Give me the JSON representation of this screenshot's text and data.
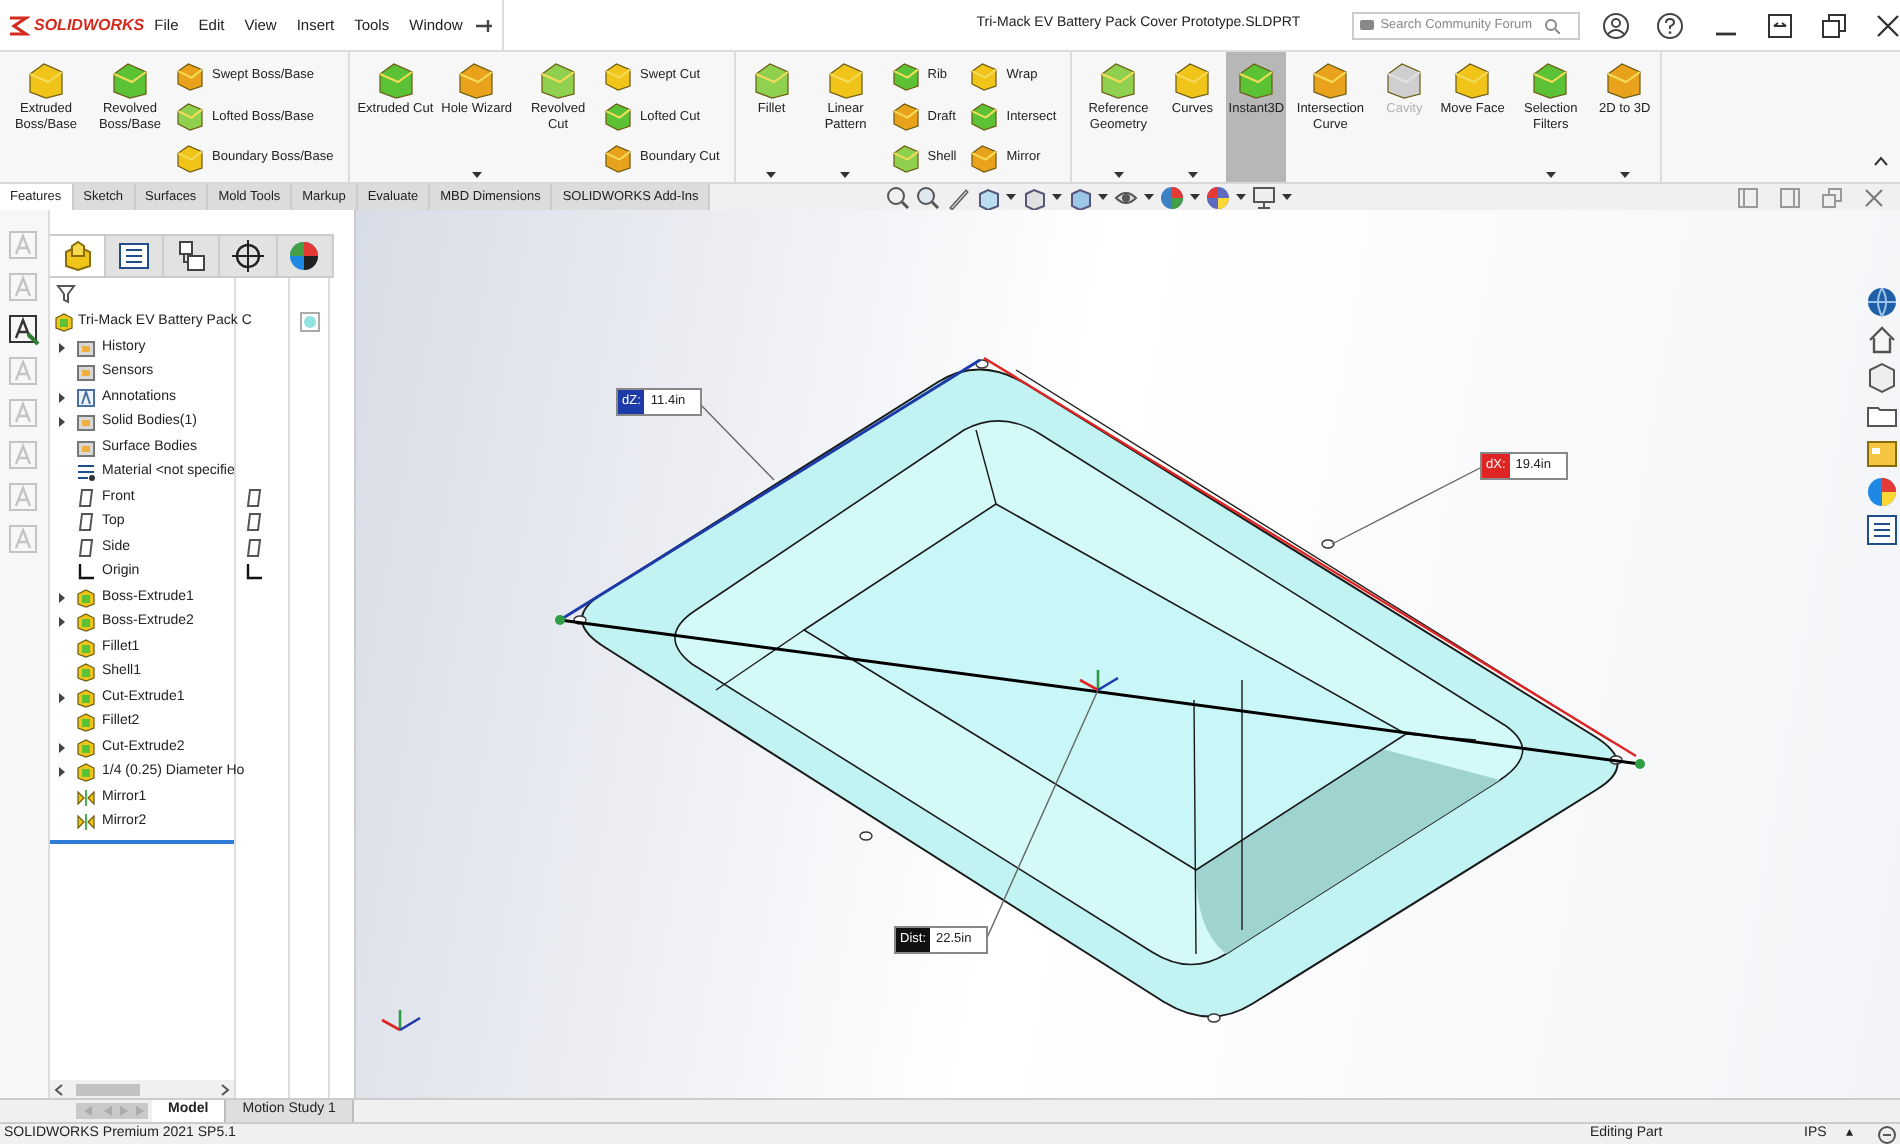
{
  "app": {
    "logo": "SOLIDWORKS",
    "menu": [
      "File",
      "Edit",
      "View",
      "Insert",
      "Tools",
      "Window"
    ],
    "document_title": "Tri-Mack EV Battery Pack Cover Prototype.SLDPRT",
    "search": {
      "placeholder": "Search Community Forum"
    }
  },
  "ribbon": {
    "groups": [
      {
        "columns": [
          {
            "kind": "large",
            "label": "Extruded Boss/Base",
            "caret": false,
            "selected": false,
            "disabled": false
          },
          {
            "kind": "large",
            "label": "Revolved Boss/Base",
            "caret": false,
            "selected": false,
            "disabled": false
          },
          {
            "kind": "small",
            "items": [
              "Swept Boss/Base",
              "Lofted Boss/Base",
              "Boundary Boss/Base"
            ]
          }
        ]
      },
      {
        "columns": [
          {
            "kind": "large",
            "label": "Extruded Cut",
            "caret": false,
            "selected": false,
            "disabled": false
          },
          {
            "kind": "large",
            "label": "Hole Wizard",
            "caret": true,
            "selected": false,
            "disabled": false
          },
          {
            "kind": "large",
            "label": "Revolved Cut",
            "caret": false,
            "selected": false,
            "disabled": false
          },
          {
            "kind": "small",
            "items": [
              "Swept Cut",
              "Lofted Cut",
              "Boundary Cut"
            ]
          }
        ]
      },
      {
        "columns": [
          {
            "kind": "large",
            "label": "Fillet",
            "caret": true,
            "selected": false,
            "disabled": false
          },
          {
            "kind": "large",
            "label": "Linear Pattern",
            "caret": true,
            "selected": false,
            "disabled": false
          },
          {
            "kind": "small",
            "items": [
              "Rib",
              "Draft",
              "Shell"
            ]
          },
          {
            "kind": "small",
            "items": [
              "Wrap",
              "Intersect",
              "Mirror"
            ]
          }
        ]
      },
      {
        "columns": [
          {
            "kind": "large",
            "label": "Reference Geometry",
            "caret": true,
            "selected": false,
            "disabled": false
          },
          {
            "kind": "large",
            "label": "Curves",
            "caret": true,
            "selected": false,
            "disabled": false
          },
          {
            "kind": "large",
            "label": "Instant3D",
            "caret": false,
            "selected": true,
            "disabled": false
          },
          {
            "kind": "large",
            "label": "Intersection Curve",
            "caret": false,
            "selected": false,
            "disabled": false
          },
          {
            "kind": "large",
            "label": "Cavity",
            "caret": false,
            "selected": false,
            "disabled": true
          },
          {
            "kind": "large",
            "label": "Move Face",
            "caret": false,
            "selected": false,
            "disabled": false
          },
          {
            "kind": "large",
            "label": "Selection Filters",
            "caret": true,
            "selected": false,
            "disabled": false
          },
          {
            "kind": "large",
            "label": "2D to 3D",
            "caret": true,
            "selected": false,
            "disabled": false
          }
        ]
      }
    ]
  },
  "command_tabs": [
    {
      "label": "Features",
      "selected": true
    },
    {
      "label": "Sketch",
      "selected": false
    },
    {
      "label": "Surfaces",
      "selected": false
    },
    {
      "label": "Mold Tools",
      "selected": false
    },
    {
      "label": "Markup",
      "selected": false
    },
    {
      "label": "Evaluate",
      "selected": false
    },
    {
      "label": "MBD Dimensions",
      "selected": false
    },
    {
      "label": "SOLIDWORKS Add-Ins",
      "selected": false
    }
  ],
  "left_toolbar": [
    {
      "disabled": true
    },
    {
      "disabled": true
    },
    {
      "disabled": false
    },
    {
      "disabled": true
    },
    {
      "disabled": true
    },
    {
      "disabled": true
    },
    {
      "disabled": true
    },
    {
      "disabled": true
    }
  ],
  "panel_tabs": [
    {
      "kind": "part",
      "selected": true
    },
    {
      "kind": "properties",
      "selected": false
    },
    {
      "kind": "configurations",
      "selected": false
    },
    {
      "kind": "target",
      "selected": false
    },
    {
      "kind": "appearance",
      "selected": false
    }
  ],
  "feature_tree": {
    "name": "Tri-Mack EV Battery Pack C",
    "children": [
      {
        "name": "History",
        "kind": "folder",
        "expandable": true
      },
      {
        "name": "Sensors",
        "kind": "folder",
        "expandable": false
      },
      {
        "name": "Annotations",
        "kind": "annotation",
        "expandable": true
      },
      {
        "name": "Solid Bodies(1)",
        "kind": "folder",
        "expandable": true
      },
      {
        "name": "Surface Bodies",
        "kind": "folder",
        "expandable": false
      },
      {
        "name": "Material <not specifie",
        "kind": "material",
        "expandable": false
      },
      {
        "name": "Front",
        "kind": "plane",
        "expandable": false
      },
      {
        "name": "Top",
        "kind": "plane",
        "expandable": false
      },
      {
        "name": "Side",
        "kind": "plane",
        "expandable": false
      },
      {
        "name": "Origin",
        "kind": "origin",
        "expandable": false
      },
      {
        "name": "Boss-Extrude1",
        "kind": "feature",
        "expandable": true
      },
      {
        "name": "Boss-Extrude2",
        "kind": "feature",
        "expandable": true
      },
      {
        "name": "Fillet1",
        "kind": "feature",
        "expandable": false
      },
      {
        "name": "Shell1",
        "kind": "feature",
        "expandable": false
      },
      {
        "name": "Cut-Extrude1",
        "kind": "feature",
        "expandable": true
      },
      {
        "name": "Fillet2",
        "kind": "feature",
        "expandable": false
      },
      {
        "name": "Cut-Extrude2",
        "kind": "feature",
        "expandable": true
      },
      {
        "name": "1/4 (0.25) Diameter Ho",
        "kind": "feature",
        "expandable": true
      },
      {
        "name": "Mirror1",
        "kind": "mirror",
        "expandable": false
      },
      {
        "name": "Mirror2",
        "kind": "mirror",
        "expandable": false
      }
    ]
  },
  "measurements": [
    {
      "label": "dZ:",
      "value": "11.4in",
      "color": "#1c3aa8"
    },
    {
      "label": "dX:",
      "value": "19.4in",
      "color": "#e02424"
    },
    {
      "label": "Dist:",
      "value": "22.5in",
      "color": "#111111"
    }
  ],
  "model_tabs": [
    {
      "label": "Model",
      "selected": true
    },
    {
      "label": "Motion Study 1",
      "selected": false
    }
  ],
  "status_bar": {
    "product": "SOLIDWORKS Premium 2021 SP5.1",
    "mode": "Editing Part",
    "units": "IPS",
    "caret": "▴"
  }
}
